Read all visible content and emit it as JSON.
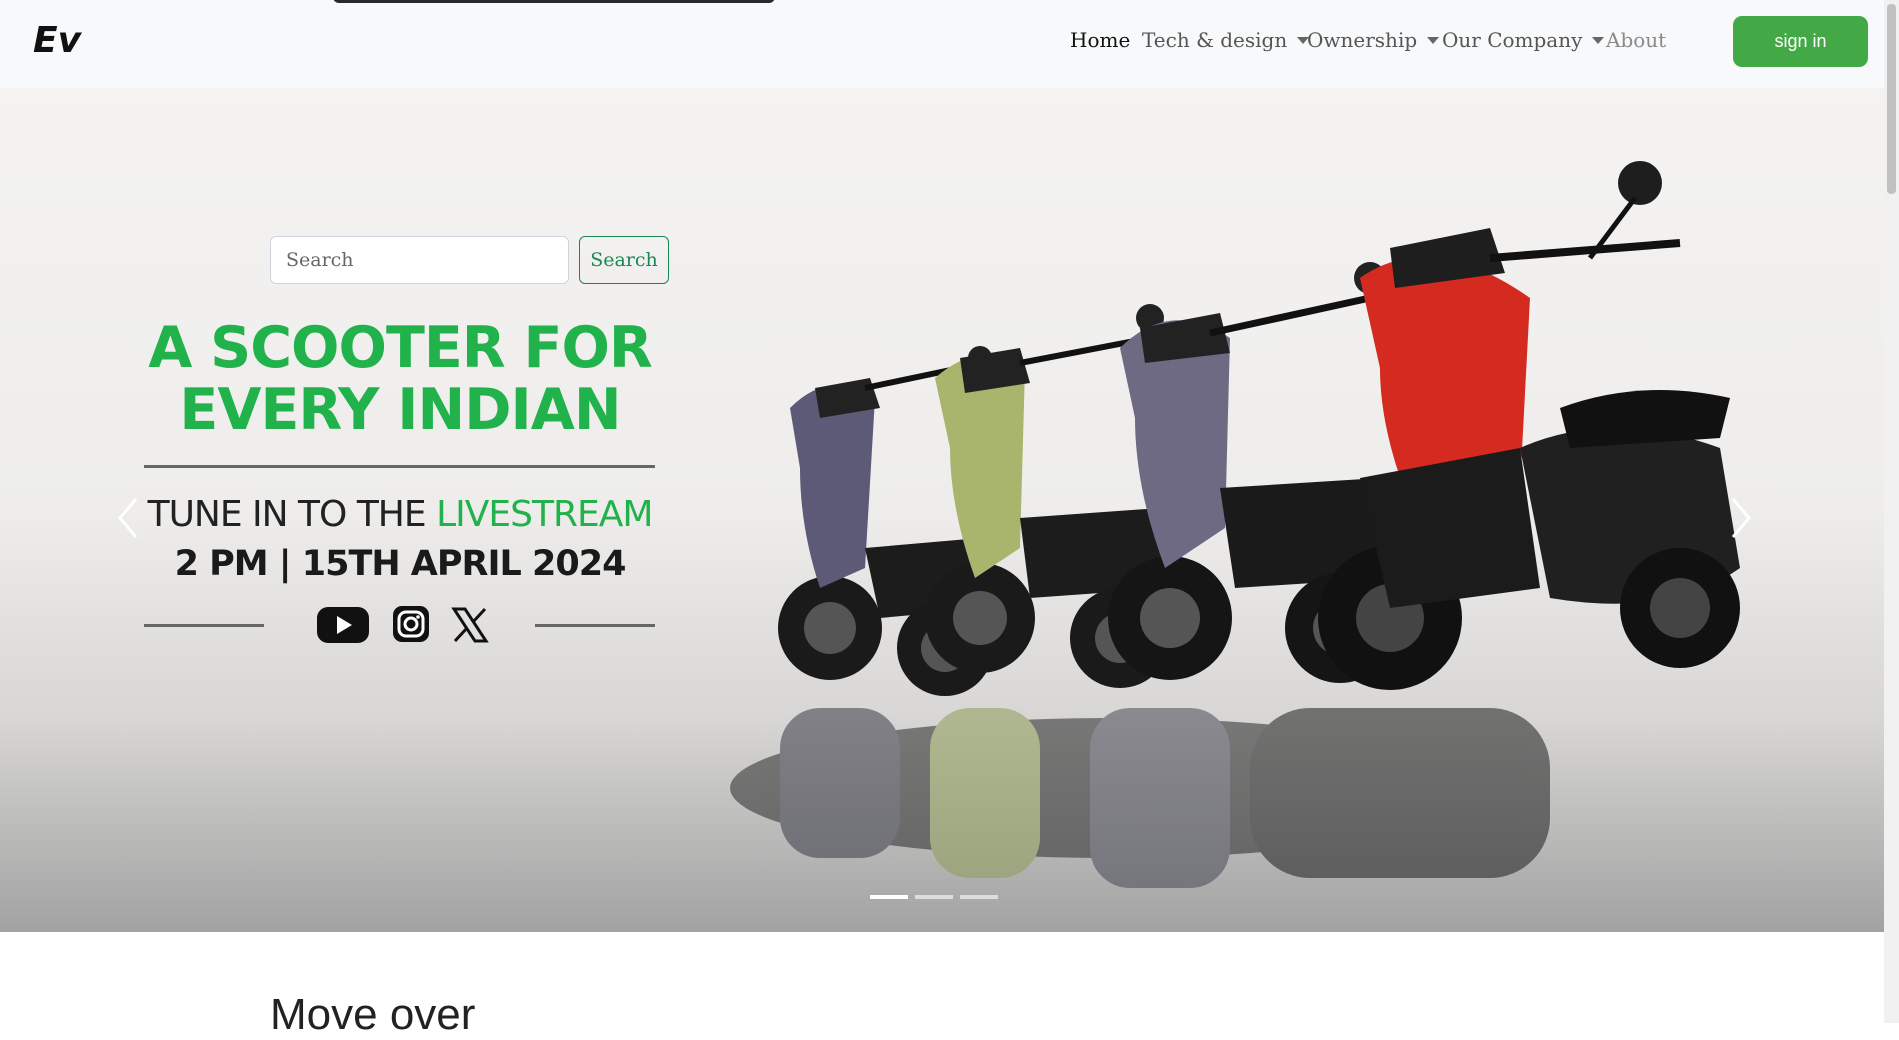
{
  "brand": "Ev",
  "nav": {
    "items": [
      {
        "label": "Home",
        "dropdown": false
      },
      {
        "label": "Tech & design",
        "dropdown": true
      },
      {
        "label": "Ownership",
        "dropdown": true
      },
      {
        "label": "Our Company",
        "dropdown": true
      },
      {
        "label": "About",
        "dropdown": false
      }
    ],
    "signin_label": "sign in"
  },
  "search": {
    "placeholder": "Search",
    "button_label": "Search"
  },
  "hero": {
    "headline_line1": "A SCOOTER FOR",
    "headline_line2": "EVERY INDIAN",
    "tune_prefix": "TUNE IN TO THE ",
    "tune_highlight": "LIVESTREAM",
    "date": "2 PM | 15TH APRIL 2024",
    "social_icons": [
      "youtube-icon",
      "instagram-icon",
      "x-icon"
    ],
    "carousel_active_slide": 1,
    "carousel_slides": 3
  },
  "section": {
    "title": "Move over"
  },
  "colors": {
    "accent_green": "#22b24c",
    "signin_green": "#43a947",
    "nav_bg": "#f8f9fa"
  }
}
